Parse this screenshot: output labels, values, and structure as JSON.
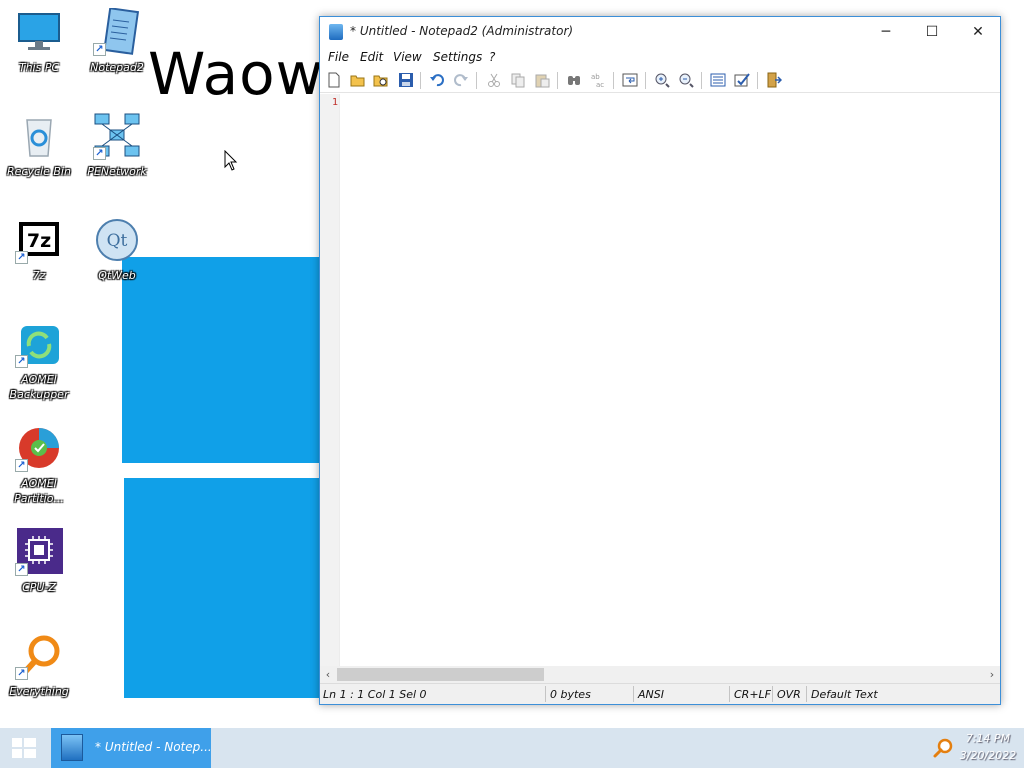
{
  "wallpaper": {
    "title_text": "Waows",
    "accent_color": "#10a0e8"
  },
  "desktop_icons": [
    {
      "label": "This PC",
      "icon": "monitor-icon"
    },
    {
      "label": "Notepad2",
      "icon": "notepad-icon"
    },
    {
      "label": "Recycle Bin",
      "icon": "recycle-bin-icon"
    },
    {
      "label": "PENetwork",
      "icon": "network-icon"
    },
    {
      "label": "7z",
      "icon": "7zip-icon"
    },
    {
      "label": "QtWeb",
      "icon": "qt-icon"
    },
    {
      "label": "AOMEI Backupper",
      "icon": "backup-icon"
    },
    {
      "label": "AOMEI Partitio...",
      "icon": "partition-icon"
    },
    {
      "label": "CPU-Z",
      "icon": "cpu-icon"
    },
    {
      "label": "Everything",
      "icon": "search-magnifier-icon"
    }
  ],
  "window": {
    "title": "* Untitled - Notepad2 (Administrator)",
    "controls": {
      "minimize": "─",
      "maximize": "☐",
      "close": "✕"
    },
    "menu": [
      "File",
      "Edit",
      "View",
      "Settings",
      "?"
    ],
    "toolbar": [
      "new",
      "open",
      "browse",
      "save",
      "undo",
      "redo",
      "cut",
      "copy",
      "paste",
      "find",
      "replace",
      "word-wrap",
      "zoom-in",
      "zoom-out",
      "scheme",
      "customize-scheme",
      "exit"
    ],
    "gutter": {
      "line_number": "1"
    },
    "scroll": {
      "left_arrow": "‹",
      "right_arrow": "›"
    },
    "status": {
      "position": "Ln 1 : 1   Col 1   Sel 0",
      "size": "0 bytes",
      "encoding": "ANSI",
      "line_endings": "CR+LF",
      "mode": "OVR",
      "scheme": "Default Text"
    }
  },
  "taskbar": {
    "task_label": "* Untitled - Notep...",
    "time": "7:14 PM",
    "date": "3/20/2022"
  }
}
